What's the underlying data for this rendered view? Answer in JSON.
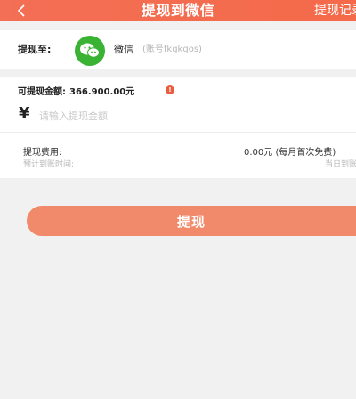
{
  "header": {
    "title": "提现到微信",
    "right_link": "提现记录"
  },
  "withdraw_to": {
    "label": "提现至:",
    "method": "微信",
    "account": "(账号fkgkgos)"
  },
  "balance": {
    "label": "可提现金额:",
    "amount": "366.900.00元",
    "info_glyph": "!"
  },
  "input": {
    "currency_symbol": "¥",
    "placeholder": "请输入提现金额"
  },
  "fee": {
    "label": "提现费用:",
    "value": "0.00元 (每月首次免费)"
  },
  "eta": {
    "label": "预计到账时间:",
    "value": "当日到账"
  },
  "submit": {
    "label": "提现"
  },
  "colors": {
    "accent": "#f46a4a",
    "button": "#f08a6a",
    "wechat_green": "#3ab234"
  }
}
